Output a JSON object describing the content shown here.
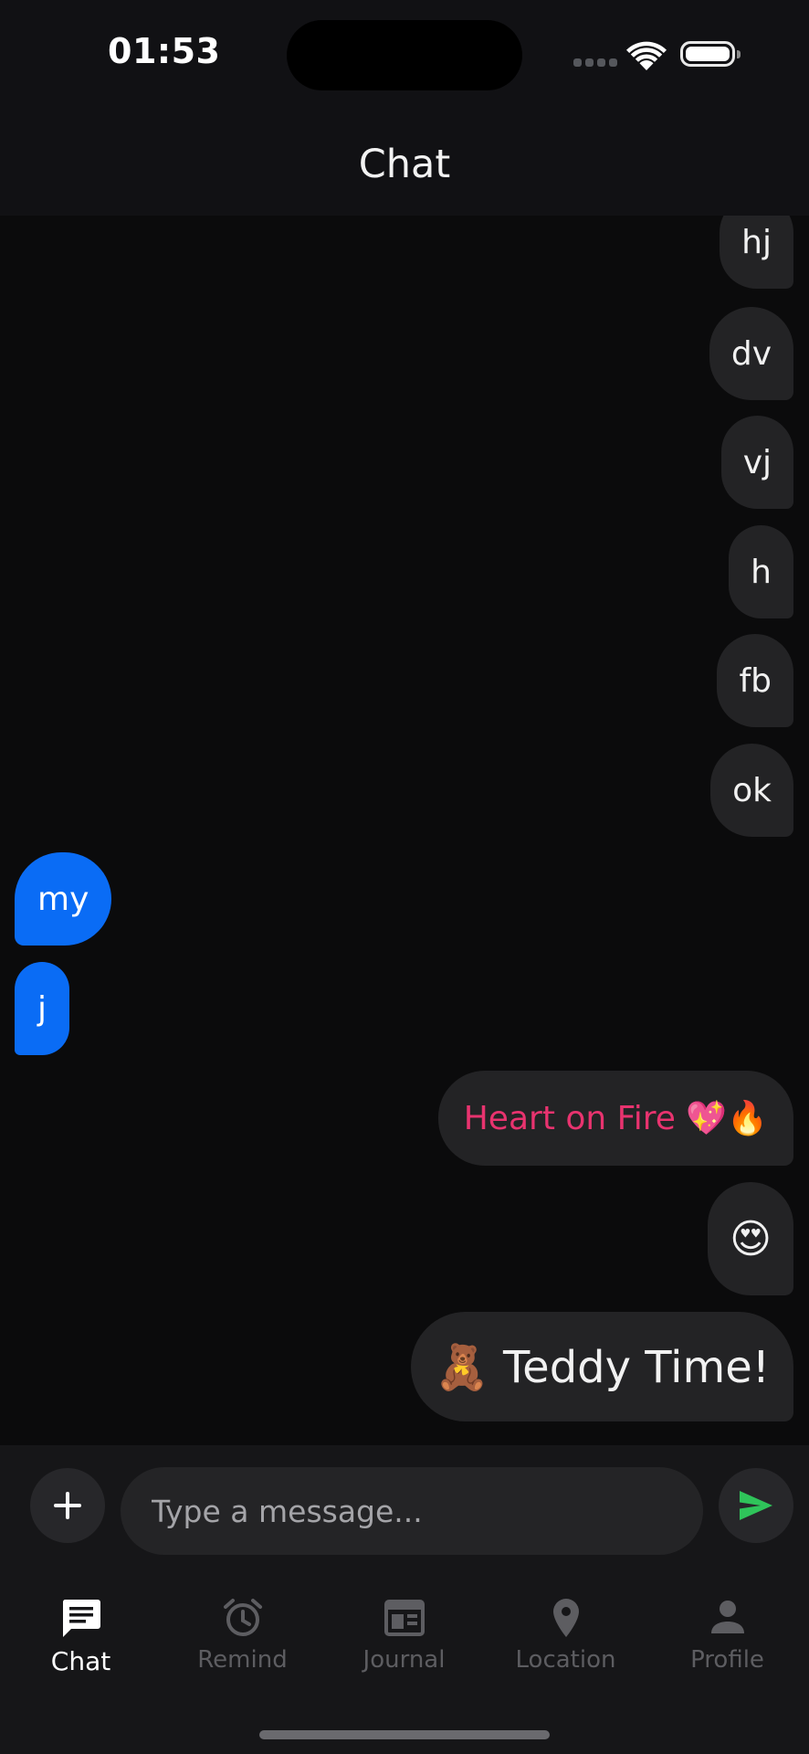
{
  "status_bar": {
    "time": "01:53"
  },
  "header": {
    "title": "Chat"
  },
  "messages": [
    {
      "text": "hj",
      "direction": "outgoing"
    },
    {
      "text": "dv",
      "direction": "outgoing"
    },
    {
      "text": "vj",
      "direction": "outgoing"
    },
    {
      "text": "h",
      "direction": "outgoing"
    },
    {
      "text": "fb",
      "direction": "outgoing"
    },
    {
      "text": "ok",
      "direction": "outgoing"
    },
    {
      "text": "my",
      "direction": "incoming"
    },
    {
      "text": "j",
      "direction": "incoming"
    },
    {
      "text": "Heart on Fire 💖🔥",
      "direction": "outgoing"
    },
    {
      "text": "😍",
      "direction": "outgoing"
    },
    {
      "text": "🧸 Teddy Time!",
      "direction": "outgoing"
    }
  ],
  "composer": {
    "placeholder": "Type a message...",
    "add_icon": "plus-icon",
    "send_icon": "send-icon"
  },
  "tabs": [
    {
      "label": "Chat",
      "icon": "chat-bubble-icon",
      "active": true
    },
    {
      "label": "Remind",
      "icon": "alarm-clock-icon",
      "active": false
    },
    {
      "label": "Journal",
      "icon": "journal-icon",
      "active": false
    },
    {
      "label": "Location",
      "icon": "location-pin-icon",
      "active": false
    },
    {
      "label": "Profile",
      "icon": "person-icon",
      "active": false
    }
  ],
  "colors": {
    "background": "#0b0b0c",
    "outgoing_bubble": "#232325",
    "incoming_bubble": "#0a6cf5",
    "accent_pink": "#e8336f",
    "send_green": "#2fc45a",
    "inactive_tab": "#5d5d61"
  }
}
